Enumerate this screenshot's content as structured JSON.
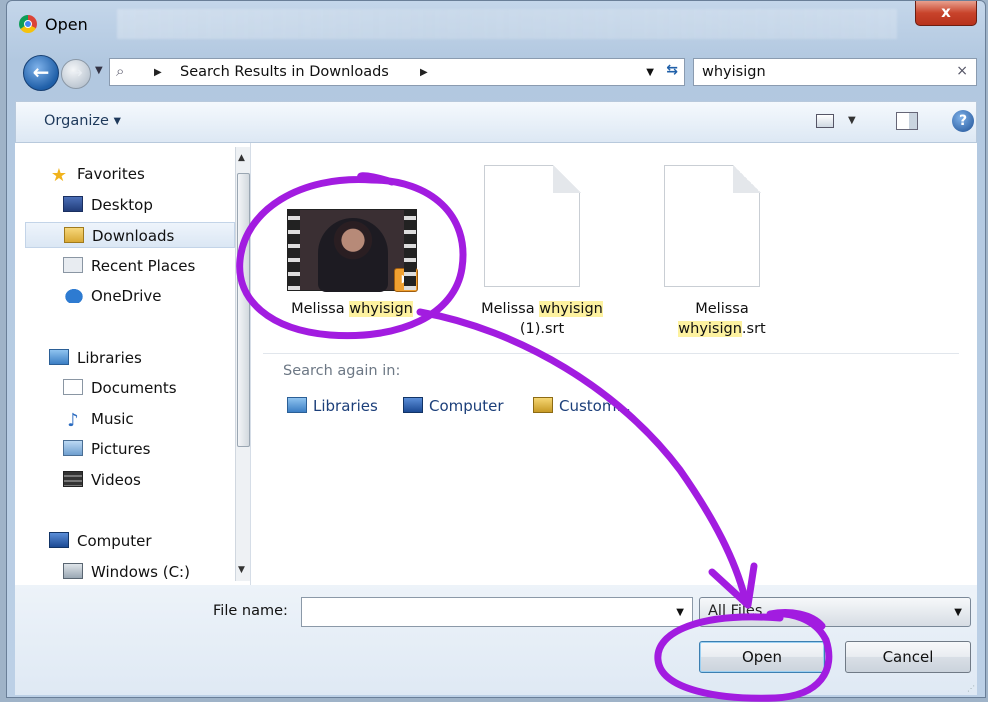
{
  "window": {
    "title": "Open",
    "close_label": "x"
  },
  "address_bar": {
    "breadcrumb": "Search Results in Downloads",
    "search_value": "whyisign"
  },
  "toolbar": {
    "organize_label": "Organize ▾"
  },
  "nav_pane": {
    "favorites": {
      "label": "Favorites",
      "items": [
        "Desktop",
        "Downloads",
        "Recent Places",
        "OneDrive"
      ]
    },
    "libraries": {
      "label": "Libraries",
      "items": [
        "Documents",
        "Music",
        "Pictures",
        "Videos"
      ]
    },
    "computer": {
      "label": "Computer",
      "items": [
        "Windows (C:)"
      ]
    },
    "selected_item": "Downloads"
  },
  "files": [
    {
      "name_prefix": "Melissa ",
      "name_highlight": "whyisign",
      "name_suffix": "",
      "type": "video"
    },
    {
      "name_prefix": "Melissa ",
      "name_highlight": "whyisign",
      "name_suffix": "(1).srt",
      "type": "document"
    },
    {
      "name_prefix": "Melissa",
      "name_highlight": "whyisign",
      "name_suffix": ".srt",
      "type": "document"
    }
  ],
  "search_again": {
    "label": "Search again in:",
    "locations": [
      "Libraries",
      "Computer",
      "Custom..."
    ]
  },
  "footer": {
    "file_name_label": "File name:",
    "file_name_value": "",
    "filter_value": "All Files",
    "open_label": "Open",
    "cancel_label": "Cancel"
  },
  "annotation": {
    "color": "#a21ce0",
    "description_shapes": [
      "circle-around-video-file",
      "curved-arrow",
      "circle-around-open-button"
    ]
  }
}
